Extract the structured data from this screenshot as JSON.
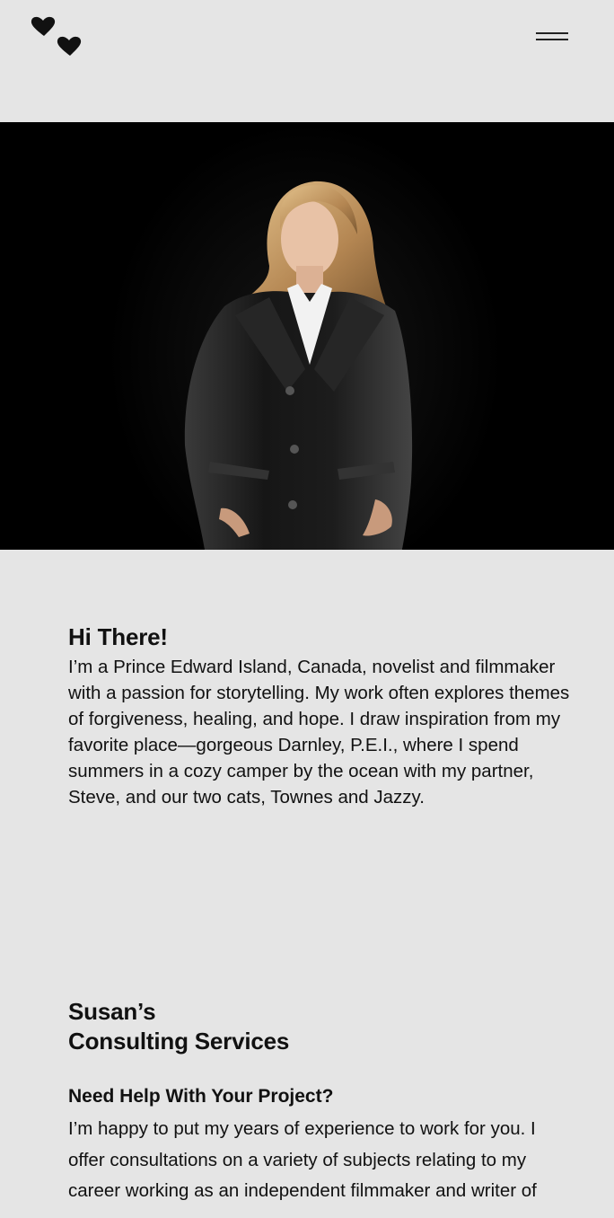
{
  "header": {
    "logo_icon": "hearts-logo-icon",
    "menu_icon": "hamburger-menu-icon"
  },
  "hero": {
    "image": "portrait of woman in black leather jacket on black background"
  },
  "intro": {
    "heading": "Hi There!",
    "text": "I’m a Prince Edward Island, Canada, novelist and filmmaker with a passion for storytelling. My work often explores themes of forgiveness, healing, and hope. I draw inspiration from my favorite place—gorgeous Darnley, P.E.I., where I spend summers in a cozy camper by the ocean with my partner, Steve, and our two cats, Townes and Jazzy."
  },
  "services": {
    "heading_line1": "Susan’s",
    "heading_line2": "Consulting Services",
    "subheading": "Need Help With Your Project?",
    "text": "I’m happy to put my years of experience to work for you. I offer consultations on a variety of subjects relating to my career working as an independent filmmaker and writer of"
  },
  "colors": {
    "background": "#e5e5e5",
    "text": "#111111",
    "hero_background": "#000000"
  }
}
